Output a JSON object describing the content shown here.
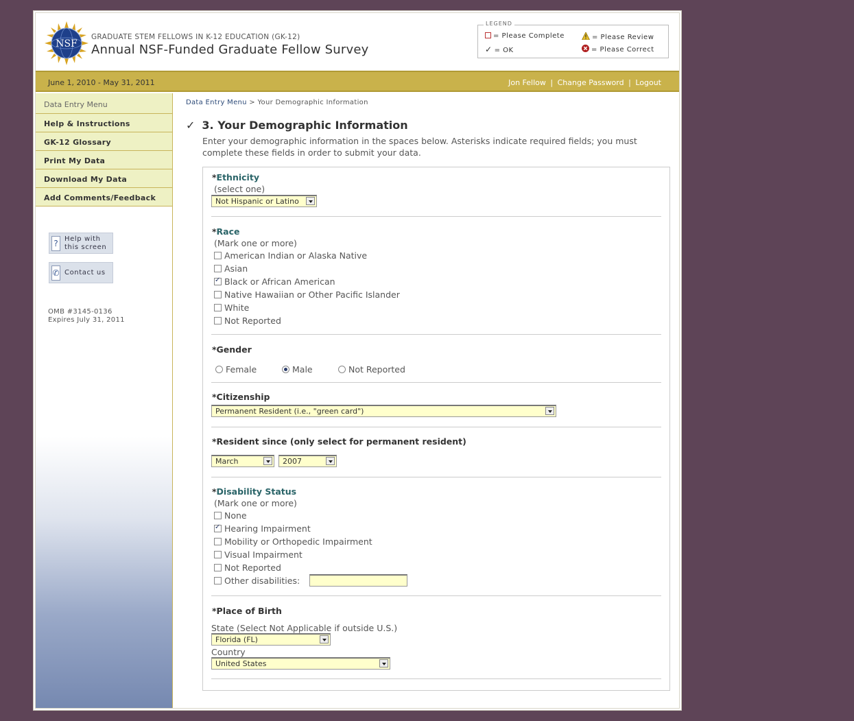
{
  "header": {
    "subtitle": "GRADUATE STEM FELLOWS IN K-12 EDUCATION (GK-12)",
    "title": "Annual NSF-Funded Graduate Fellow Survey",
    "logo_text": "NSF",
    "legend": {
      "title": "LEGEND",
      "complete": "= Please Complete",
      "review": "= Please Review",
      "ok": "= OK",
      "correct": "= Please Correct"
    }
  },
  "bar": {
    "period": "June 1, 2010 - May 31, 2011",
    "user": "Jon Fellow",
    "change_password": "Change Password",
    "logout": "Logout",
    "sep": "|"
  },
  "sidebar": {
    "menu_title": "Data Entry Menu",
    "items": [
      {
        "label": "Help & Instructions"
      },
      {
        "label": "GK-12 Glossary"
      },
      {
        "label": "Print My Data"
      },
      {
        "label": "Download My Data"
      },
      {
        "label": "Add Comments/Feedback"
      }
    ],
    "help_line1": "Help with",
    "help_line2": "this screen",
    "contact": "Contact us",
    "omb_line1": "OMB #3145-0136",
    "omb_line2": "Expires July 31, 2011"
  },
  "breadcrumb": {
    "link": "Data Entry Menu",
    "sep": ">",
    "current": "Your Demographic Information"
  },
  "page": {
    "check": "✓",
    "heading": "3. Your Demographic Information",
    "intro": "Enter your demographic information in the spaces below. Asterisks indicate required fields; you must complete these fields in order to submit your data."
  },
  "form": {
    "required_mark": "*",
    "ethnicity": {
      "label": "Ethnicity",
      "hint": "(select one)",
      "value": "Not Hispanic or Latino"
    },
    "race": {
      "label": "Race",
      "hint": "(Mark one or more)",
      "options": [
        {
          "label": "American Indian or Alaska Native",
          "checked": false
        },
        {
          "label": "Asian",
          "checked": false
        },
        {
          "label": "Black or African American",
          "checked": true
        },
        {
          "label": "Native Hawaiian or Other Pacific Islander",
          "checked": false
        },
        {
          "label": "White",
          "checked": false
        },
        {
          "label": "Not Reported",
          "checked": false
        }
      ]
    },
    "gender": {
      "label": "Gender",
      "options": [
        {
          "label": "Female",
          "checked": false
        },
        {
          "label": "Male",
          "checked": true
        },
        {
          "label": "Not Reported",
          "checked": false
        }
      ]
    },
    "citizenship": {
      "label": "Citizenship",
      "value": "Permanent Resident (i.e., \"green card\")"
    },
    "resident": {
      "label": "Resident since (only select for permanent resident)",
      "month": "March",
      "year": "2007"
    },
    "disability": {
      "label": "Disability Status",
      "hint": "(Mark one or more)",
      "options": [
        {
          "label": "None",
          "checked": false
        },
        {
          "label": "Hearing Impairment",
          "checked": true
        },
        {
          "label": "Mobility or Orthopedic Impairment",
          "checked": false
        },
        {
          "label": "Visual Impairment",
          "checked": false
        },
        {
          "label": "Not Reported",
          "checked": false
        },
        {
          "label": "Other disabilities:",
          "checked": false
        }
      ],
      "other_value": ""
    },
    "birth": {
      "label": "Place of Birth",
      "state_label": "State (Select Not Applicable if outside U.S.)",
      "state_value": "Florida (FL)",
      "country_label": "Country",
      "country_value": "United States"
    }
  },
  "colors": {
    "background": "#5e4457",
    "gold_bar": "#c9b24b",
    "menu_bg": "#eef1c4",
    "field_bg": "#ffffcc",
    "link": "#2a6468"
  }
}
